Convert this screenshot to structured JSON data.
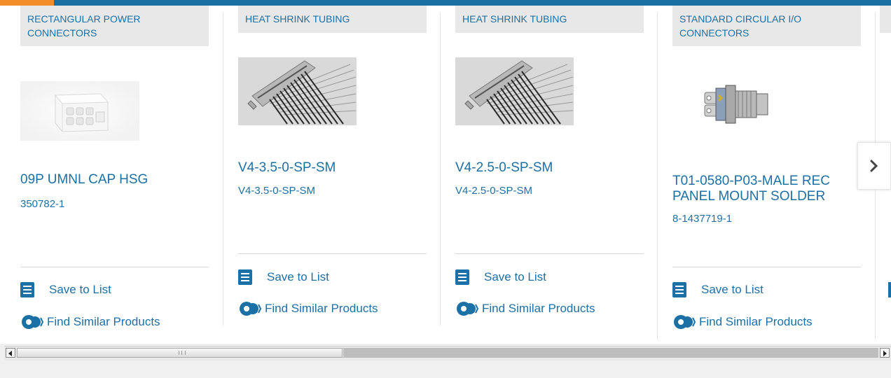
{
  "carousel": {
    "products": [
      {
        "category": "RECTANGULAR POWER CONNECTORS",
        "title": "09P UMNL CAP HSG",
        "part_number": "350782-1",
        "image": "white-rectangular-connector",
        "save_label": "Save to List",
        "find_label": "Find Similar Products"
      },
      {
        "category": "HEAT SHRINK TUBING",
        "title": "V4-3.5-0-SP-SM",
        "part_number": "V4-3.5-0-SP-SM",
        "image": "d-sub-connector-with-wires",
        "save_label": "Save to List",
        "find_label": "Find Similar Products"
      },
      {
        "category": "HEAT SHRINK TUBING",
        "title": "V4-2.5-0-SP-SM",
        "part_number": "V4-2.5-0-SP-SM",
        "image": "d-sub-connector-with-wires",
        "save_label": "Save to List",
        "find_label": "Find Similar Products"
      },
      {
        "category": "STANDARD CIRCULAR I/O CONNECTORS",
        "title": "T01-0580-P03-MALE REC PANEL MOUNT SOLDER",
        "part_number": "8-1437719-1",
        "image": "circular-panel-mount-connector",
        "save_label": "Save to List",
        "find_label": "Find Similar Products"
      }
    ],
    "next_icon": "chevron-right-icon"
  },
  "colors": {
    "link": "#1b70a6",
    "brand_bar": "#1a6fa3",
    "accent": "#f28c28",
    "category_bg": "#e8e8e8"
  }
}
